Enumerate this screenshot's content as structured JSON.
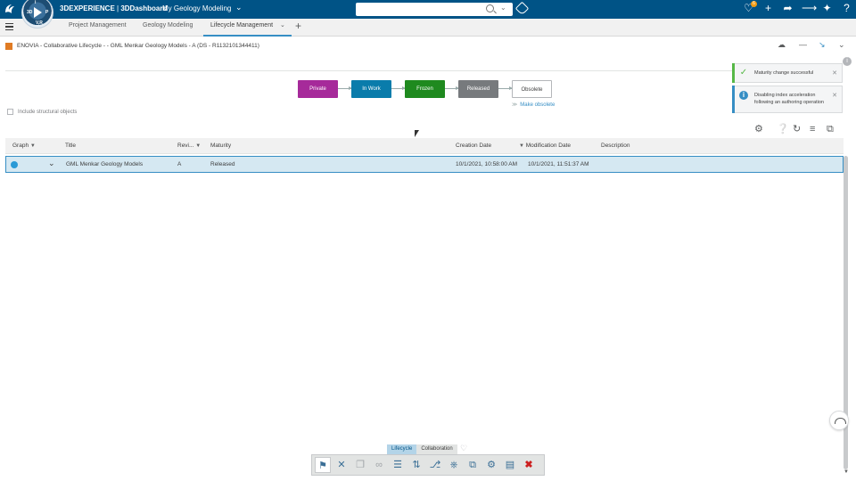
{
  "topbar": {
    "brand_prefix": "3DEXPERIENCE",
    "brand_suffix": "3DDashboard",
    "dashboard_title": "My Geology Modeling",
    "compass_quadrants": [
      "3D",
      "P",
      "V,R",
      "i"
    ],
    "notification_count": "6",
    "search_value": ""
  },
  "tabs": [
    {
      "label": "Project Management"
    },
    {
      "label": "Geology Modeling"
    },
    {
      "label": "Lifecycle Management"
    }
  ],
  "widget": {
    "title": "ENOVIA - Collaborative Lifecycle - - GML Menkar Geology Models - A (DS - R1132101344411)"
  },
  "maturity": {
    "states": [
      {
        "label": "Private",
        "color": "#a62a9a"
      },
      {
        "label": "In Work",
        "color": "#0a7cab"
      },
      {
        "label": "Frozen",
        "color": "#1f8a1f"
      },
      {
        "label": "Released",
        "color": "#777a7d"
      },
      {
        "label": "Obsolete",
        "color": "#ffffff"
      }
    ],
    "make_obsolete_label": "Make obsolete"
  },
  "include_structural_label": "Include structural objects",
  "notifications": [
    {
      "text": "Maturity change successful",
      "type": "success",
      "color": "#57b847"
    },
    {
      "text": "Disabling index acceleration following an authoring operation",
      "type": "info",
      "color": "#368ec4"
    }
  ],
  "table": {
    "columns": [
      "Graph",
      "Title",
      "Revi...",
      "Maturity",
      "Creation Date",
      "Modification Date",
      "Description"
    ],
    "rows": [
      {
        "title": "GML Menkar Geology Models",
        "revision": "A",
        "maturity": "Released",
        "creation_date": "10/1/2021, 10:58:00 AM",
        "modification_date": "10/1/2021, 11:51:37 AM",
        "description": ""
      }
    ]
  },
  "actionbar": {
    "tabs": [
      "Lifecycle",
      "Collaboration"
    ],
    "active_tab": "Lifecycle"
  }
}
